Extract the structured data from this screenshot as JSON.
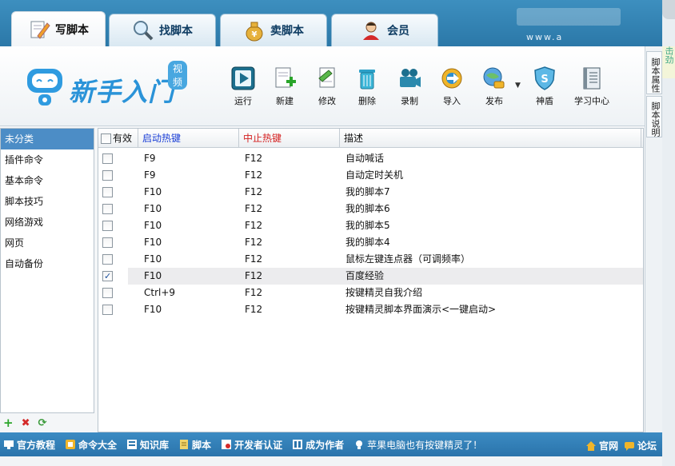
{
  "tabs": [
    {
      "label": "写脚本",
      "active": true
    },
    {
      "label": "找脚本",
      "active": false
    },
    {
      "label": "卖脚本",
      "active": false
    },
    {
      "label": "会员",
      "active": false
    }
  ],
  "header_url": "www.a",
  "logo": {
    "title": "新手入门",
    "badge": "视频"
  },
  "toolbar": [
    {
      "label": "运行",
      "icon": "play-icon"
    },
    {
      "label": "新建",
      "icon": "new-file-icon"
    },
    {
      "label": "修改",
      "icon": "edit-icon"
    },
    {
      "label": "删除",
      "icon": "trash-icon"
    },
    {
      "label": "录制",
      "icon": "camera-icon"
    },
    {
      "label": "导入",
      "icon": "import-icon"
    },
    {
      "label": "发布",
      "icon": "publish-icon"
    },
    {
      "label": "神盾",
      "icon": "shield-icon"
    },
    {
      "label": "学习中心",
      "icon": "book-icon"
    }
  ],
  "side_tabs": [
    "脚本属性",
    "脚本说明"
  ],
  "side_strip_text": "击劲",
  "categories": [
    "未分类",
    "插件命令",
    "基本命令",
    "脚本技巧",
    "网络游戏",
    "网页",
    "自动备份"
  ],
  "selected_category": "未分类",
  "left_footer": [
    "+",
    "✖",
    "⟳"
  ],
  "table": {
    "headers": {
      "enabled": "有效",
      "start": "启动热键",
      "stop": "中止热键",
      "desc": "描述"
    },
    "rows": [
      {
        "checked": false,
        "start": "F9",
        "stop": "F12",
        "desc": "自动喊话"
      },
      {
        "checked": false,
        "start": "F9",
        "stop": "F12",
        "desc": "自动定时关机"
      },
      {
        "checked": false,
        "start": "F10",
        "stop": "F12",
        "desc": "我的脚本7"
      },
      {
        "checked": false,
        "start": "F10",
        "stop": "F12",
        "desc": "我的脚本6"
      },
      {
        "checked": false,
        "start": "F10",
        "stop": "F12",
        "desc": "我的脚本5"
      },
      {
        "checked": false,
        "start": "F10",
        "stop": "F12",
        "desc": "我的脚本4"
      },
      {
        "checked": false,
        "start": "F10",
        "stop": "F12",
        "desc": "鼠标左键连点器（可调频率）"
      },
      {
        "checked": true,
        "start": "F10",
        "stop": "F12",
        "desc": "百度经验"
      },
      {
        "checked": false,
        "start": "Ctrl+9",
        "stop": "F12",
        "desc": "按键精灵自我介绍"
      },
      {
        "checked": false,
        "start": "F10",
        "stop": "F12",
        "desc": "按键精灵脚本界面演示<一键启动>"
      }
    ]
  },
  "bottom_links": [
    "官方教程",
    "命令大全",
    "知识库",
    "脚本",
    "开发者认证",
    "成为作者",
    "苹果电脑也有按键精灵了！"
  ],
  "bottom_right": [
    "官网",
    "论坛"
  ],
  "colors": {
    "start_header": "#1b3fd6",
    "stop_header": "#d42020",
    "accent": "#2b78a8"
  }
}
